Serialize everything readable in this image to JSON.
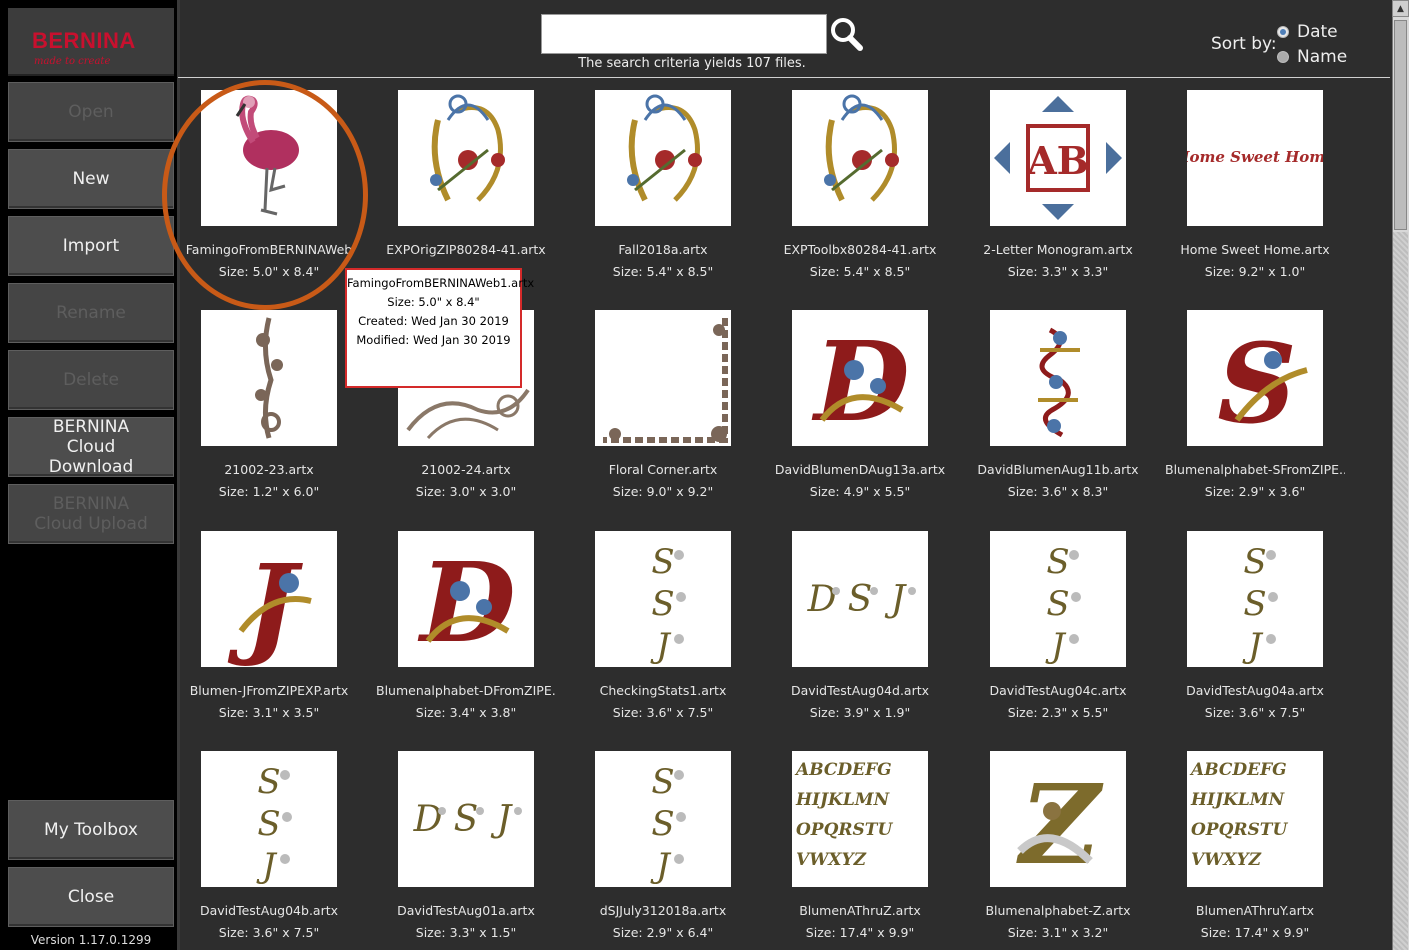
{
  "logo": {
    "brand": "BERNINA",
    "tagline": "made to create"
  },
  "sidebar": {
    "buttons": [
      {
        "label": "Open",
        "enabled": false
      },
      {
        "label": "New",
        "enabled": true
      },
      {
        "label": "Import",
        "enabled": true
      },
      {
        "label": "Rename",
        "enabled": false
      },
      {
        "label": "Delete",
        "enabled": false
      },
      {
        "label": "BERNINA Cloud Download",
        "enabled": true
      },
      {
        "label": "BERNINA Cloud Upload",
        "enabled": false
      },
      {
        "label": "My Toolbox",
        "enabled": true
      },
      {
        "label": "Close",
        "enabled": true
      }
    ],
    "version": "Version 1.17.0.1299"
  },
  "search": {
    "value": "",
    "status": "The search criteria yields 107 files.",
    "icon": "magnifier-icon"
  },
  "sort": {
    "label": "Sort by:",
    "options": [
      {
        "label": "Date",
        "checked": true
      },
      {
        "label": "Name",
        "checked": false
      }
    ]
  },
  "colors": {
    "accent": "#c8102e",
    "highlight": "#c85a17",
    "tooltip_border": "#d42a2a",
    "background": "#2d2d2d"
  },
  "files": [
    {
      "name": "FamingoFromBERNINAWeb",
      "size": "Size: 5.0\" x 8.4\"",
      "art": "flamingo"
    },
    {
      "name": "EXPOrigZIP80284-41.artx",
      "size": "",
      "art": "floral-bouquet"
    },
    {
      "name": "Fall2018a.artx",
      "size": "Size: 5.4\" x 8.5\"",
      "art": "floral-bouquet"
    },
    {
      "name": "EXPToolbx80284-41.artx",
      "size": "Size: 5.4\" x 8.5\"",
      "art": "floral-bouquet"
    },
    {
      "name": "2-Letter Monogram.artx",
      "size": "Size: 3.3\" x 3.3\"",
      "art": "monogram"
    },
    {
      "name": "Home Sweet Home.artx",
      "size": "Size: 9.2\" x 1.0\"",
      "art": "text"
    },
    {
      "name": "21002-23.artx",
      "size": "Size: 1.2\" x 6.0\"",
      "art": "vine"
    },
    {
      "name": "21002-24.artx",
      "size": "Size: 3.0\" x 3.0\"",
      "art": "swirl"
    },
    {
      "name": "Floral Corner.artx",
      "size": "Size: 9.0\" x 9.2\"",
      "art": "corner"
    },
    {
      "name": "DavidBlumenDAug13a.artx",
      "size": "Size: 4.9\" x 5.5\"",
      "art": "letter-d"
    },
    {
      "name": "DavidBlumenAug11b.artx",
      "size": "Size: 3.6\" x 8.3\"",
      "art": "stack-red"
    },
    {
      "name": "Blumenalphabet-SFromZIPE...",
      "size": "Size: 2.9\" x 3.6\"",
      "art": "letter-s"
    },
    {
      "name": "Blumen-JFromZIPEXP.artx",
      "size": "Size: 3.1\" x 3.5\"",
      "art": "letter-j"
    },
    {
      "name": "Blumenalphabet-DFromZIPE...",
      "size": "Size: 3.4\" x 3.8\"",
      "art": "letter-d"
    },
    {
      "name": "CheckingStats1.artx",
      "size": "Size: 3.6\" x 7.5\"",
      "art": "stack-olive"
    },
    {
      "name": "DavidTestAug04d.artx",
      "size": "Size: 3.9\" x 1.9\"",
      "art": "row-olive"
    },
    {
      "name": "DavidTestAug04c.artx",
      "size": "Size: 2.3\" x 5.5\"",
      "art": "stack-olive"
    },
    {
      "name": "DavidTestAug04a.artx",
      "size": "Size: 3.6\" x 7.5\"",
      "art": "stack-olive"
    },
    {
      "name": "DavidTestAug04b.artx",
      "size": "Size: 3.6\" x 7.5\"",
      "art": "stack-olive"
    },
    {
      "name": "DavidTestAug01a.artx",
      "size": "Size: 3.3\" x 1.5\"",
      "art": "row-olive"
    },
    {
      "name": "dSJJuly312018a.artx",
      "size": "Size: 2.9\" x 6.4\"",
      "art": "stack-olive"
    },
    {
      "name": "BlumenAThruZ.artx",
      "size": "Size: 17.4\" x 9.9\"",
      "art": "alphabet"
    },
    {
      "name": "Blumenalphabet-Z.artx",
      "size": "Size: 3.1\" x 3.2\"",
      "art": "letter-z"
    },
    {
      "name": "BlumenAThruY.artx",
      "size": "Size: 17.4\" x 9.9\"",
      "art": "alphabet"
    }
  ],
  "tooltip": {
    "filename": "FamingoFromBERNINAWeb1.artx",
    "size": "Size: 5.0\" x 8.4\"",
    "created": "Created: Wed Jan 30 2019",
    "modified": "Modified: Wed Jan 30 2019"
  }
}
